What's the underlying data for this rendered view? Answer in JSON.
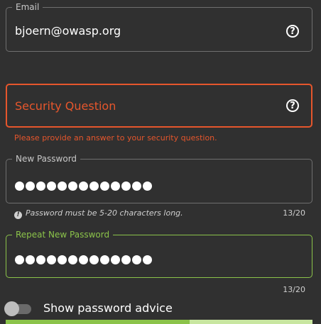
{
  "email": {
    "label": "Email",
    "value": "bjoern@owasp.org",
    "help_icon": "help-circle-icon"
  },
  "security_question": {
    "placeholder": "Security Question",
    "error": "Please provide an answer to your security question.",
    "help_icon": "help-circle-icon"
  },
  "new_password": {
    "label": "New Password",
    "masked_length": 13,
    "hint": "Password must be 5-20 characters long.",
    "counter": "13/20",
    "hint_icon": "exclamation-circle-icon"
  },
  "repeat_password": {
    "label": "Repeat New Password",
    "masked_length": 13,
    "counter": "13/20"
  },
  "advice_toggle": {
    "label": "Show password advice",
    "checked": false
  },
  "colors": {
    "error": "#e6562c",
    "success": "#8bc34a",
    "page_bg": "#303030"
  }
}
